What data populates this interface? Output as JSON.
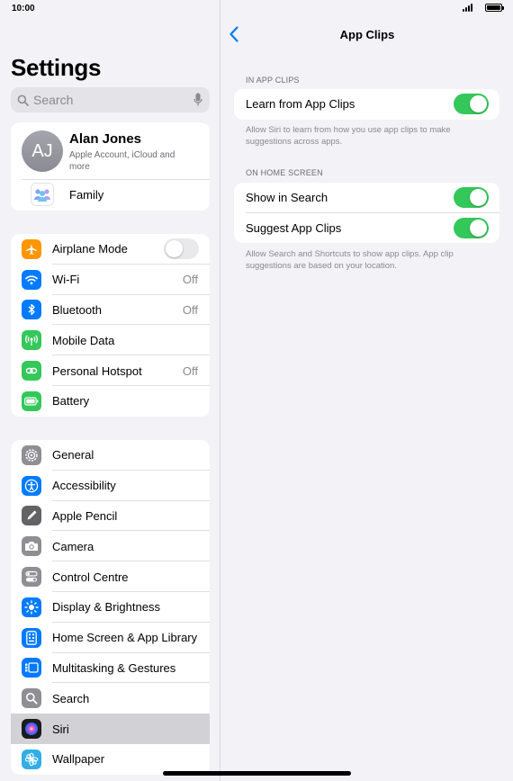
{
  "status": {
    "time": "10:00"
  },
  "sidebar": {
    "title": "Settings",
    "search_placeholder": "Search",
    "profile": {
      "initials": "AJ",
      "name": "Alan Jones",
      "subtitle": "Apple Account, iCloud and more",
      "family": "Family"
    },
    "group1": [
      {
        "label": "Airplane Mode",
        "toggle": "off",
        "color": "#ff9500",
        "icon": "airplane-icon"
      },
      {
        "label": "Wi-Fi",
        "value": "Off",
        "color": "#007aff",
        "icon": "wifi-icon"
      },
      {
        "label": "Bluetooth",
        "value": "Off",
        "color": "#007aff",
        "icon": "bluetooth-icon"
      },
      {
        "label": "Mobile Data",
        "color": "#34c759",
        "icon": "antenna-icon"
      },
      {
        "label": "Personal Hotspot",
        "value": "Off",
        "color": "#34c759",
        "icon": "hotspot-icon"
      },
      {
        "label": "Battery",
        "color": "#34c759",
        "icon": "battery-icon"
      }
    ],
    "group2": [
      {
        "label": "General",
        "color": "#8e8e93",
        "icon": "gear-icon"
      },
      {
        "label": "Accessibility",
        "color": "#007aff",
        "icon": "accessibility-icon"
      },
      {
        "label": "Apple Pencil",
        "color": "#636366",
        "icon": "pencil-icon"
      },
      {
        "label": "Camera",
        "color": "#8e8e93",
        "icon": "camera-icon"
      },
      {
        "label": "Control Centre",
        "color": "#8e8e93",
        "icon": "switches-icon"
      },
      {
        "label": "Display & Brightness",
        "color": "#007aff",
        "icon": "sun-icon"
      },
      {
        "label": "Home Screen & App Library",
        "color": "#007aff",
        "icon": "home-screen-icon"
      },
      {
        "label": "Multitasking & Gestures",
        "color": "#007aff",
        "icon": "multitasking-icon"
      },
      {
        "label": "Search",
        "color": "#8e8e93",
        "icon": "search-icon"
      },
      {
        "label": "Siri",
        "color": "#1c1c1e",
        "icon": "siri-icon",
        "selected": true
      },
      {
        "label": "Wallpaper",
        "color": "#32ade6",
        "icon": "flower-icon"
      }
    ]
  },
  "detail": {
    "title": "App Clips",
    "section1": {
      "header": "IN APP CLIPS",
      "rows": [
        {
          "label": "Learn from App Clips",
          "toggle": "on"
        }
      ],
      "footer": "Allow Siri to learn from how you use app clips to make suggestions across apps."
    },
    "section2": {
      "header": "ON HOME SCREEN",
      "rows": [
        {
          "label": "Show in Search",
          "toggle": "on"
        },
        {
          "label": "Suggest App Clips",
          "toggle": "on"
        }
      ],
      "footer": "Allow Search and Shortcuts to show app clips. App clip suggestions are based on your location."
    }
  }
}
